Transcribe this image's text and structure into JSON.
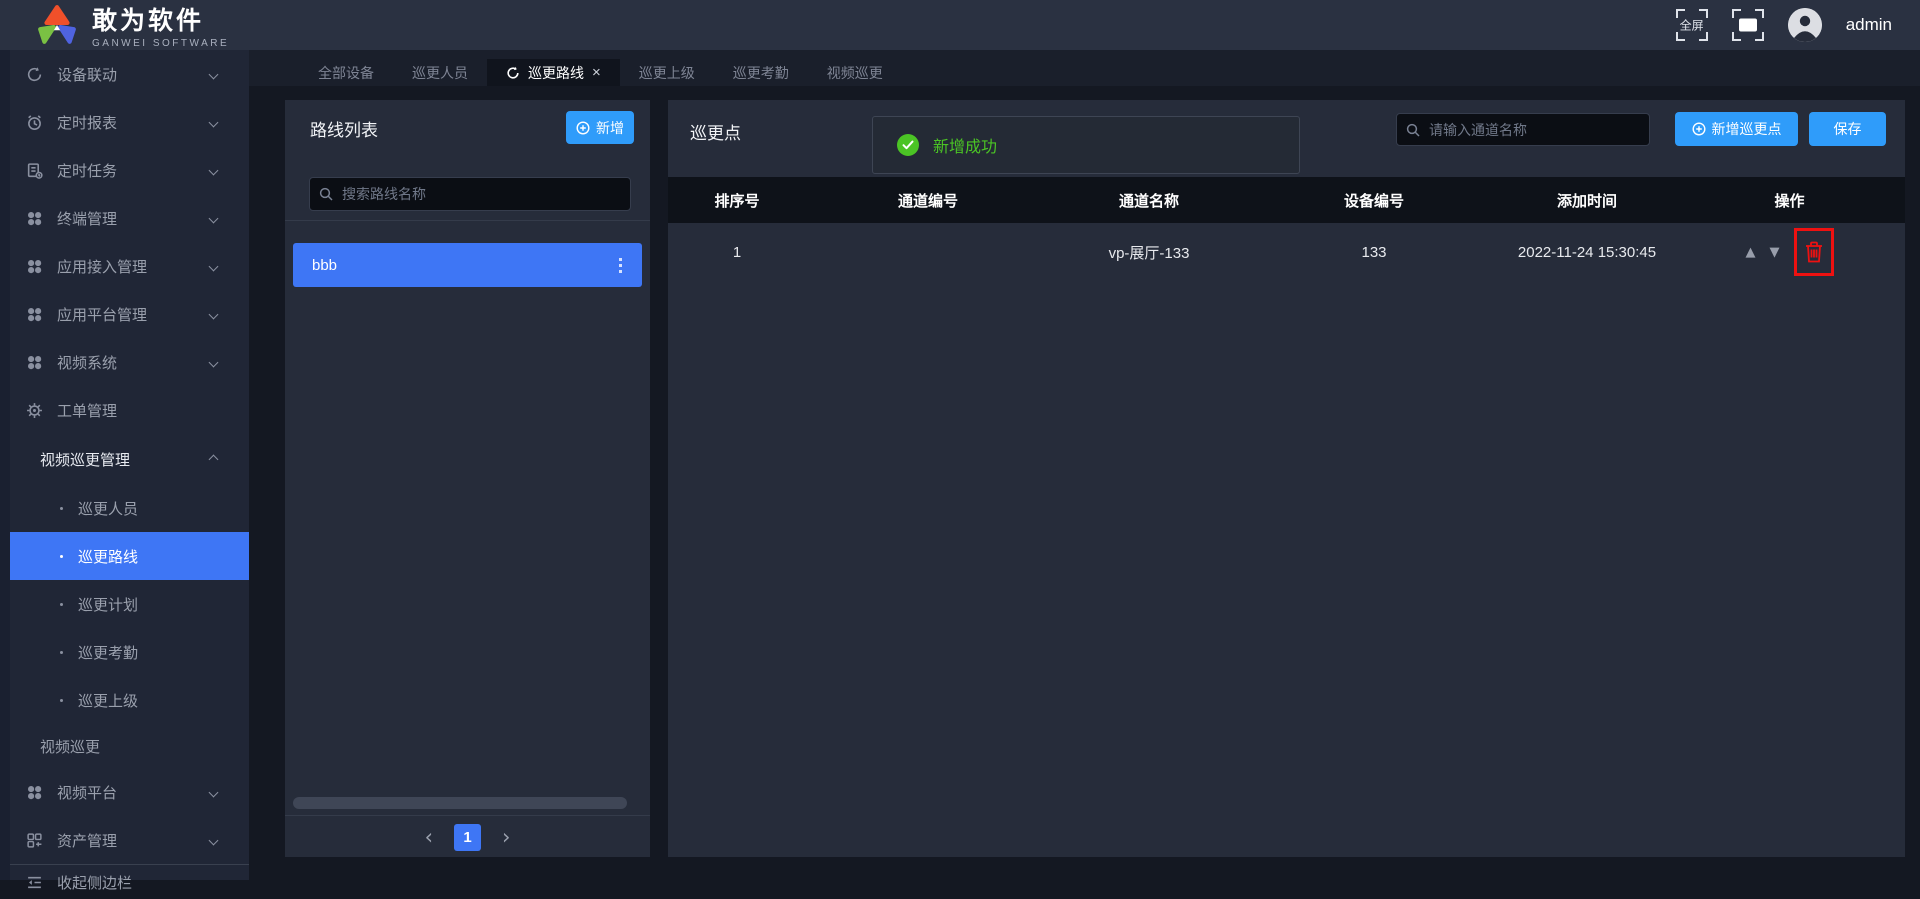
{
  "brand": {
    "name": "敢为软件",
    "subtitle": "GANWEI SOFTWARE"
  },
  "topbar": {
    "fullscreen_label": "全屏",
    "username": "admin"
  },
  "sidebar": {
    "items": [
      {
        "icon": "sync-icon",
        "label": "设备联动",
        "chevron": "down"
      },
      {
        "icon": "clock-icon",
        "label": "定时报表",
        "chevron": "down"
      },
      {
        "icon": "task-icon",
        "label": "定时任务",
        "chevron": "down"
      },
      {
        "icon": "grid-icon",
        "label": "终端管理",
        "chevron": "down"
      },
      {
        "icon": "grid-icon",
        "label": "应用接入管理",
        "chevron": "down"
      },
      {
        "icon": "grid-icon",
        "label": "应用平台管理",
        "chevron": "down"
      },
      {
        "icon": "grid-icon",
        "label": "视频系统",
        "chevron": "down"
      },
      {
        "icon": "gear-icon",
        "label": "工单管理",
        "chevron": "none"
      }
    ],
    "group": {
      "label": "视频巡更管理",
      "chevron": "up"
    },
    "subitems": [
      {
        "label": "巡更人员",
        "active": false
      },
      {
        "label": "巡更路线",
        "active": true
      },
      {
        "label": "巡更计划",
        "active": false
      },
      {
        "label": "巡更考勤",
        "active": false
      },
      {
        "label": "巡更上级",
        "active": false
      }
    ],
    "group2": {
      "label": "视频巡更"
    },
    "items2": [
      {
        "icon": "grid-icon",
        "label": "视频平台",
        "chevron": "down"
      },
      {
        "icon": "asset-icon",
        "label": "资产管理",
        "chevron": "down"
      }
    ],
    "collapse": {
      "label": "收起侧边栏"
    }
  },
  "tabs": [
    {
      "label": "全部设备",
      "active": false
    },
    {
      "label": "巡更人员",
      "active": false
    },
    {
      "label": "巡更路线",
      "active": true,
      "closable": true
    },
    {
      "label": "巡更上级",
      "active": false
    },
    {
      "label": "巡更考勤",
      "active": false
    },
    {
      "label": "视频巡更",
      "active": false
    }
  ],
  "route_panel": {
    "title": "路线列表",
    "add_button": "新增",
    "search_placeholder": "搜索路线名称",
    "routes": [
      {
        "name": "bbb",
        "selected": true
      }
    ],
    "pagination": {
      "prev": "‹",
      "current": "1",
      "next": "›"
    }
  },
  "point_panel": {
    "title": "巡更点",
    "toast": {
      "message": "新增成功",
      "status": "success"
    },
    "search_placeholder": "请输入通道名称",
    "add_button": "新增巡更点",
    "save_button": "保存",
    "table": {
      "headers": [
        "排序号",
        "通道编号",
        "通道名称",
        "设备编号",
        "添加时间",
        "操作"
      ],
      "rows": [
        {
          "order": "1",
          "channel_no": "",
          "channel_name": "vp-展厅-133",
          "device_no": "133",
          "added_time": "2022-11-24 15:30:45",
          "up": "▲",
          "down": "▼"
        }
      ]
    }
  },
  "colors": {
    "accent_blue": "#2f9cfa",
    "selection_blue": "#3e76f5",
    "success_green": "#4bc425",
    "annotation_red": "#ee1111",
    "logo_orange": "#f0502a",
    "logo_green": "#7ac143",
    "logo_blue": "#4f63e0"
  }
}
